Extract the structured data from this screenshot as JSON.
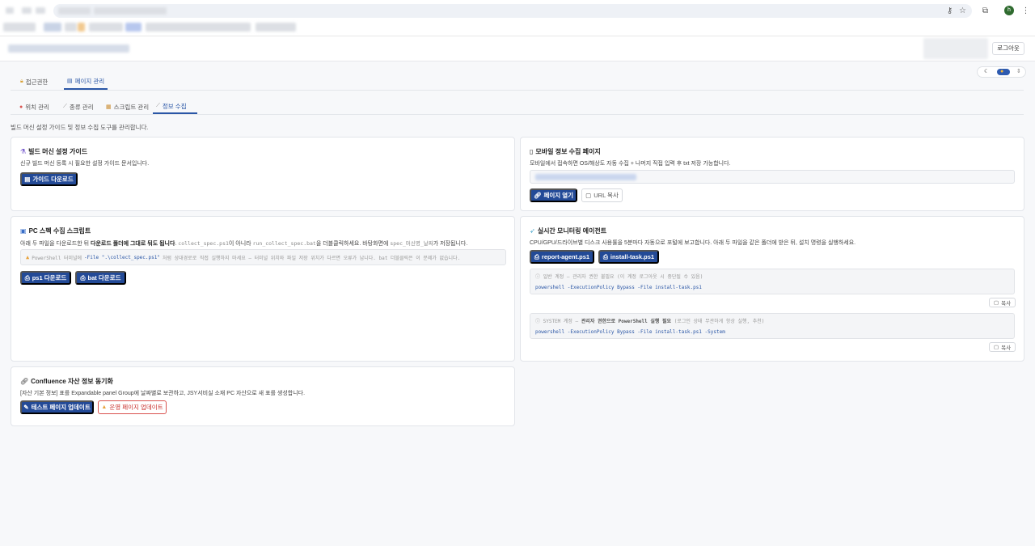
{
  "app": {
    "logout_label": "로그아웃",
    "accent_color": "#234a97",
    "danger_color": "#d9534f"
  },
  "top_tabs": [
    {
      "label": "접근권한",
      "icon": "lock-icon",
      "active": false
    },
    {
      "label": "페이지 관리",
      "icon": "page-icon",
      "active": true
    }
  ],
  "sub_tabs": [
    {
      "label": "위치 관리",
      "icon": "pin-icon",
      "active": false
    },
    {
      "label": "종류 관리",
      "icon": "tag-icon",
      "active": false
    },
    {
      "label": "스크립트 관리",
      "icon": "script-icon",
      "active": false
    },
    {
      "label": "정보 수집",
      "icon": "collect-icon",
      "active": true
    }
  ],
  "page_description": "빌드 머신 설정 가이드 및 정보 수집 도구를 관리합니다.",
  "guide_card": {
    "title": "빌드 머신 설정 가이드",
    "subtitle": "신규 빌드 머신 등록 시 필요한 설정 가이드 문서입니다.",
    "download_label": "가이드 다운로드"
  },
  "mobile_card": {
    "title": "모바일 정보 수집 페이지",
    "subtitle": "모바일에서 접속하면 OS/해상도 자동 수집 + 나머지 직접 입력 후 txt 저장 가능합니다.",
    "open_label": "페이지 열기",
    "copy_url_label": "URL 복사"
  },
  "pc_card": {
    "title": "PC 스펙 수집 스크립트",
    "sub_part1": "아래 두 파일을 다운로드한 뒤 ",
    "sub_bold": "다운로드 폴더에 그대로 둬도 됩니다",
    "sub_part2": ". ",
    "sub_code1": "collect_spec.ps1",
    "sub_part3": "이 아니라 ",
    "sub_code2": "run_collect_spec.bat",
    "sub_part4": "을 더블클릭하세요. 바탕화면에 ",
    "sub_code3": "spec_머신명_날짜",
    "sub_part5": "가 저장됩니다.",
    "warn_prefix": "PowerShell 터미널에 ",
    "warn_code": "-File \".\\collect_spec.ps1\"",
    "warn_suffix": "처럼 상대경로로 직접 실행하지 마세요 — 터미널 위치와 파일 저장 위치가 다르면 오류가 납니다. bat 더블클릭은 이 문제가 없습니다.",
    "ps1_label": "ps1 다운로드",
    "bat_label": "bat 다운로드"
  },
  "agent_card": {
    "title": "실시간 모니터링 에이전트",
    "subtitle": "CPU/GPU/드라이브별 디스크 사용률을 5분마다 자동으로 포털에 보고합니다. 아래 두 파일을 같은 폴더에 받은 뒤, 설치 명령을 실행하세요.",
    "report_label": "report-agent.ps1",
    "install_label": "install-task.ps1",
    "code1_note": "ⓘ 일반 계정 — 관리자 권한 불필요 (이 계정 로그아웃 시 중단될 수 있음)",
    "code1_cmd": "powershell -ExecutionPolicy Bypass -File install-task.ps1",
    "code2_note_a": "ⓘ SYSTEM 계정 — ",
    "code2_note_bold": "관리자 권한으로 PowerShell 실행 필요",
    "code2_note_b": " (로그인 상태 무관하게 항상 실행, 추천)",
    "code2_cmd": "powershell -ExecutionPolicy Bypass -File install-task.ps1 -System",
    "copy_label": "복사"
  },
  "confluence_card": {
    "title": "Confluence 자산 정보 동기화",
    "subtitle": "[자산 기본 정보] 표를 Expandable panel Group에 날짜별로 보관하고, JSY서비실 소재 PC 자산으로 새 표를 생성합니다.",
    "test_label": "테스트 페이지 업데이트",
    "prod_label": "운영 페이지 업데이트"
  }
}
